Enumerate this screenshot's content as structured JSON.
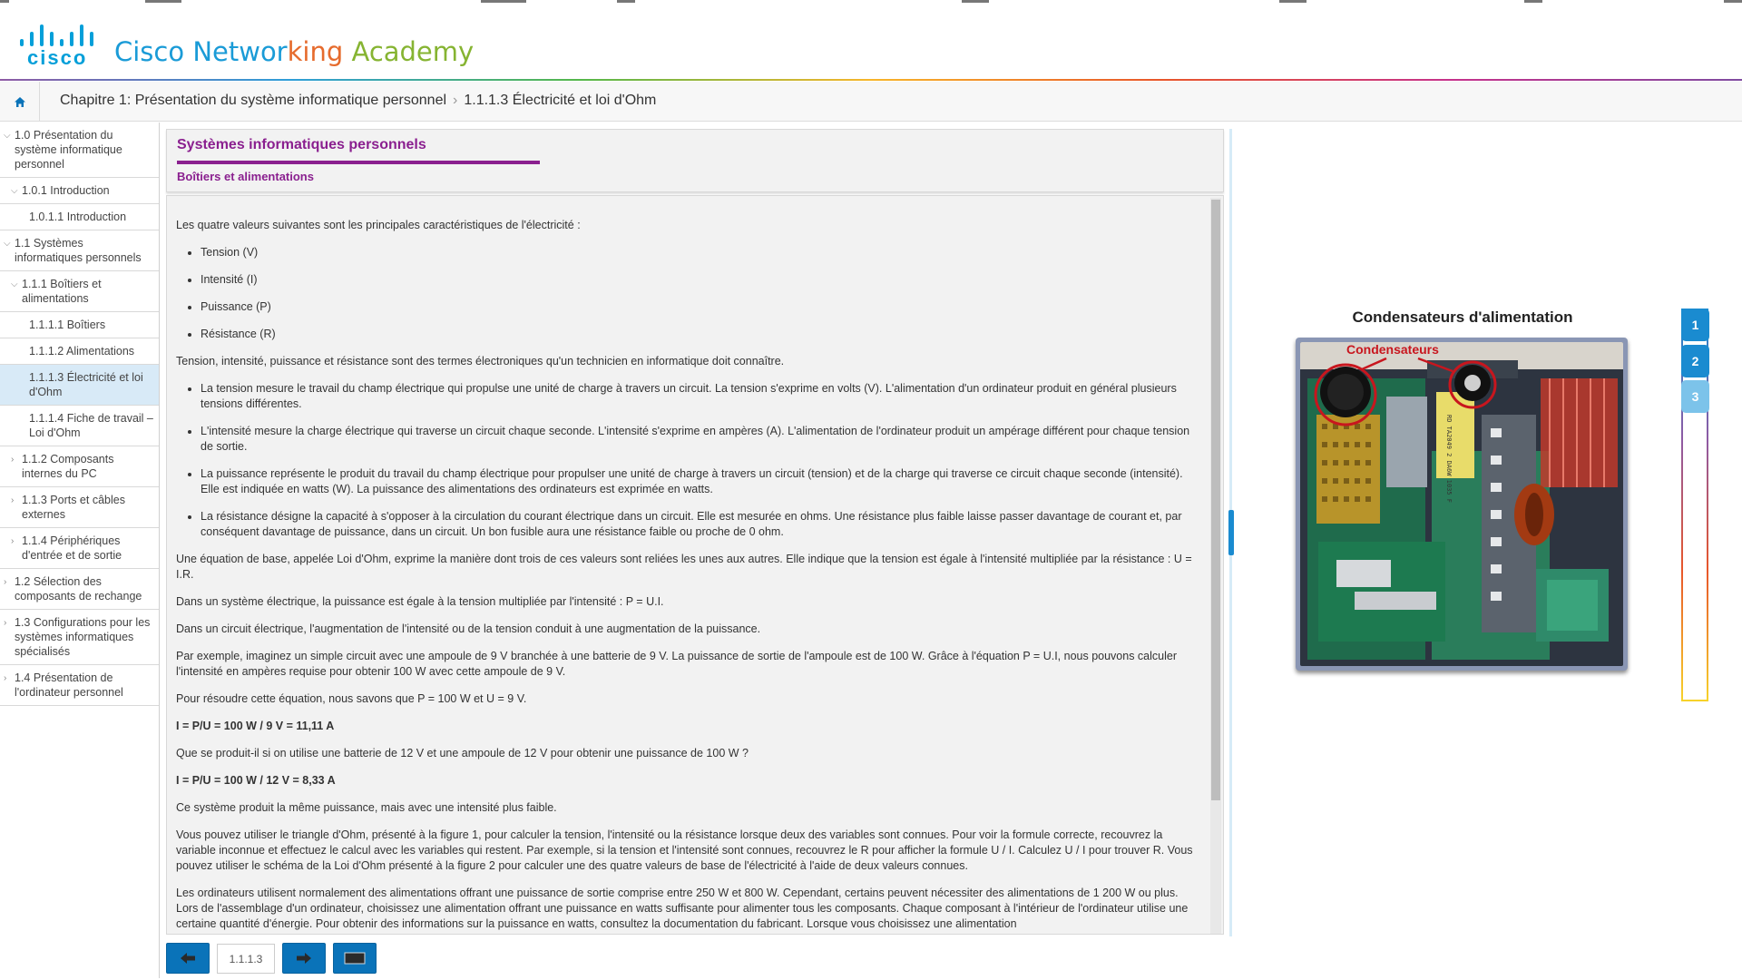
{
  "brand": {
    "logo_word": "cisco",
    "title_parts": [
      {
        "text": "Cisco Networ",
        "color": "#1a9bd7"
      },
      {
        "text": "king ",
        "color": "#e66b2d"
      },
      {
        "text": "Academy",
        "color": "#86b432"
      }
    ]
  },
  "breadcrumb": {
    "chapter": "Chapitre 1: Présentation du système informatique personnel",
    "separator": "›",
    "page": "1.1.1.3 Électricité et loi d'Ohm"
  },
  "nav": {
    "items": [
      {
        "label": "1.0 Présentation du système informatique personnel",
        "caret": "⌵"
      },
      {
        "label": "1.0.1 Introduction",
        "caret": "⌵"
      },
      {
        "label": "1.0.1.1 Introduction"
      },
      {
        "label": "1.1 Systèmes informatiques personnels",
        "caret": "⌵"
      },
      {
        "label": "1.1.1 Boîtiers et alimentations",
        "caret": "⌵"
      },
      {
        "label": "1.1.1.1 Boîtiers"
      },
      {
        "label": "1.1.1.2 Alimentations"
      },
      {
        "label": "1.1.1.3 Électricité et loi d'Ohm"
      },
      {
        "label": "1.1.1.4 Fiche de travail – Loi d'Ohm"
      },
      {
        "label": "1.1.2 Composants internes du PC",
        "caret": "›"
      },
      {
        "label": "1.1.3 Ports et câbles externes",
        "caret": "›"
      },
      {
        "label": "1.1.4 Périphériques d'entrée et de sortie",
        "caret": "›"
      },
      {
        "label": "1.2 Sélection des composants de rechange",
        "caret": "›"
      },
      {
        "label": "1.3 Configurations pour les systèmes informatiques spécialisés",
        "caret": "›"
      },
      {
        "label": "1.4 Présentation de l'ordinateur personnel",
        "caret": "›"
      }
    ]
  },
  "content": {
    "section_title": "Systèmes informatiques personnels",
    "sub_title": "Boîtiers et alimentations",
    "intro": "Les quatre valeurs suivantes sont les principales caractéristiques de l'électricité :",
    "values_list": [
      "Tension (V)",
      "Intensité (I)",
      "Puissance (P)",
      "Résistance (R)"
    ],
    "terms_sentence": "Tension, intensité, puissance et résistance sont des termes électroniques qu'un technicien en informatique doit connaître.",
    "definitions": [
      "La tension mesure le travail du champ électrique qui propulse une unité de charge à travers un circuit. La tension s'exprime en volts (V). L'alimentation d'un ordinateur produit en général plusieurs tensions différentes.",
      "L'intensité mesure la charge électrique qui traverse un circuit chaque seconde. L'intensité s'exprime en ampères (A). L'alimentation de l'ordinateur produit un ampérage différent pour chaque tension de sortie.",
      "La puissance représente le produit du travail du champ électrique pour propulser une unité de charge à travers un circuit (tension) et de la charge qui traverse ce circuit chaque seconde (intensité). Elle est indiquée en watts (W). La puissance des alimentations des ordinateurs est exprimée en watts.",
      "La résistance désigne la capacité à s'opposer à la circulation du courant électrique dans un circuit. Elle est mesurée en ohms. Une résistance plus faible laisse passer davantage de courant et, par conséquent davantage de puissance, dans un circuit. Un bon fusible aura une résistance faible ou proche de 0 ohm."
    ],
    "ohm_law": "Une équation de base, appelée Loi d'Ohm, exprime la manière dont trois de ces valeurs sont reliées les unes aux autres. Elle indique que la tension est égale à l'intensité multipliée par la résistance : U = I.R.",
    "power_eq": "Dans un système électrique, la puissance est égale à la tension multipliée par l'intensité : P = U.I.",
    "increase": "Dans un circuit électrique, l'augmentation de l'intensité ou de la tension conduit à une augmentation de la puissance.",
    "example": "Par exemple, imaginez un simple circuit avec une ampoule de 9 V branchée à une batterie de 9 V. La puissance de sortie de l'ampoule est de 100 W. Grâce à l'équation P = U.I, nous pouvons calculer l'intensité en ampères requise pour obtenir 100 W avec cette ampoule de 9 V.",
    "solve": "Pour résoudre cette équation, nous savons que P = 100 W et U = 9 V.",
    "calc1": "I = P/U = 100 W / 9 V = 11,11 A",
    "question": "Que se produit-il si on utilise une batterie de 12 V et une ampoule de 12 V pour obtenir une puissance de 100 W ?",
    "calc2": "I = P/U = 100 W / 12 V = 8,33 A",
    "same_power": "Ce système produit la même puissance, mais avec une intensité plus faible.",
    "triangle": "Vous pouvez utiliser le triangle d'Ohm, présenté à la figure 1, pour calculer la tension, l'intensité ou la résistance lorsque deux des variables sont connues. Pour voir la formule correcte, recouvrez la variable inconnue et effectuez le calcul avec les variables qui restent. Par exemple, si la tension et l'intensité sont connues, recouvrez le R pour afficher la formule U / I. Calculez U / I pour trouver R. Vous pouvez utiliser le schéma de la Loi d'Ohm présenté à la figure 2 pour calculer une des quatre valeurs de base de l'électricité à l'aide de deux valeurs connues.",
    "psu": "Les ordinateurs utilisent normalement des alimentations offrant une puissance de sortie comprise entre 250 W et 800 W. Cependant, certains peuvent nécessiter des alimentations de 1 200 W ou plus. Lors de l'assemblage d'un ordinateur, choisissez une alimentation offrant une puissance en watts suffisante pour alimenter tous les composants. Chaque composant à l'intérieur de l'ordinateur utilise une certaine quantité d'énergie. Pour obtenir des informations sur la puissance en watts, consultez la documentation du fabricant. Lorsque vous choisissez une alimentation"
  },
  "bottom_nav": {
    "page_number": "1.1.1.3"
  },
  "figure": {
    "title": "Condensateurs d'alimentation",
    "label": "Condensateurs",
    "pcb_marking": "RD TA2049 2 DA6W 1035 F"
  },
  "figure_tabs": [
    "1",
    "2",
    "3"
  ],
  "colors": {
    "accent_purple": "#8a1f8f",
    "cisco_blue": "#049fd9",
    "button_blue": "#0a73b9",
    "active_nav": "#d8eaf7",
    "tab_blue": "#1a8bd0",
    "tab_light": "#7cc3ea"
  },
  "icons": {
    "home": "home-icon",
    "prev": "arrow-left-icon",
    "next": "arrow-right-icon",
    "fullscreen": "fullscreen-icon"
  }
}
